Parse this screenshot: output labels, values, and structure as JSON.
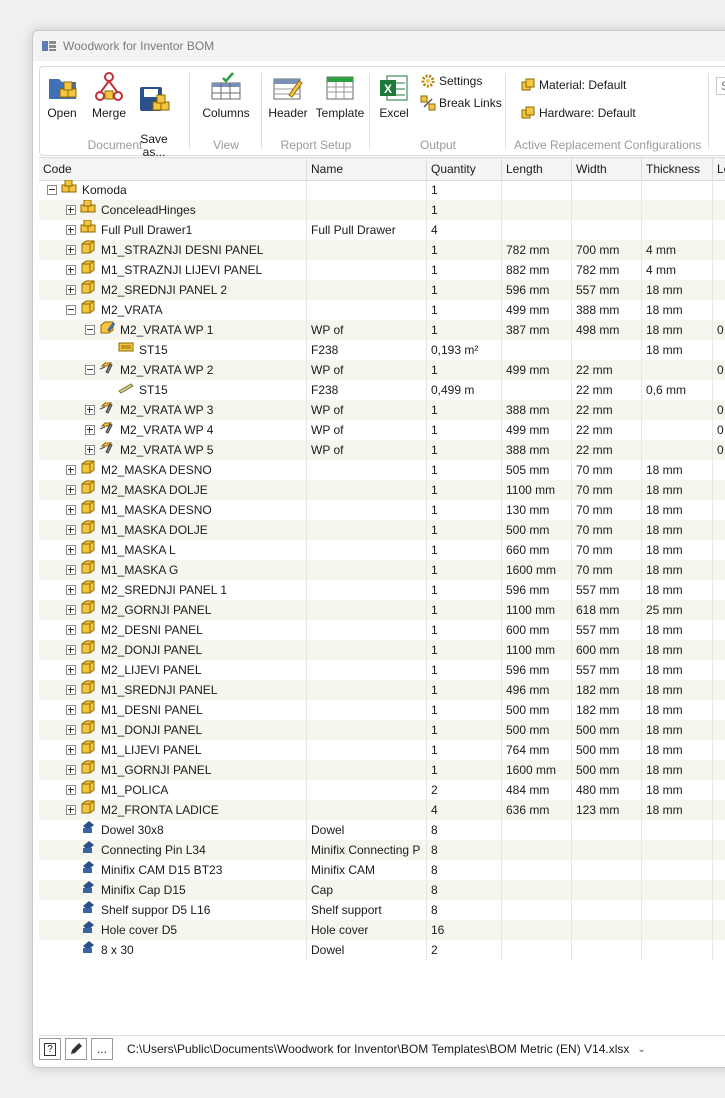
{
  "window": {
    "title": "Woodwork for Inventor BOM"
  },
  "ribbon": {
    "document": {
      "label": "Document",
      "open": "Open",
      "merge": "Merge",
      "save": "Save\nas..."
    },
    "view": {
      "label": "View",
      "columns": "Columns"
    },
    "report_setup": {
      "label": "Report Setup",
      "header": "Header",
      "template": "Template"
    },
    "output": {
      "label": "Output",
      "excel": "Excel",
      "settings": "Settings",
      "break_links": "Break Links"
    },
    "active_replacement": {
      "label": "Active Replacement Configurations",
      "material": "Material: Default",
      "hardware": "Hardware: Default"
    },
    "search_placeholder": "S"
  },
  "columns": [
    "Code",
    "Name",
    "Quantity",
    "Length",
    "Width",
    "Thickness",
    "Le"
  ],
  "rows": [
    {
      "level": 0,
      "exp": "minus",
      "icon": "assembly",
      "code": "Komoda",
      "name": "",
      "qty": "1",
      "len": "",
      "wid": "",
      "thk": "",
      "extra": ""
    },
    {
      "level": 1,
      "exp": "plus",
      "icon": "assembly",
      "code": "ConceleadHinges",
      "name": "",
      "qty": "1",
      "len": "",
      "wid": "",
      "thk": "",
      "extra": ""
    },
    {
      "level": 1,
      "exp": "plus",
      "icon": "assembly",
      "code": "Full Pull Drawer1",
      "name": "Full Pull Drawer",
      "qty": "4",
      "len": "",
      "wid": "",
      "thk": "",
      "extra": ""
    },
    {
      "level": 1,
      "exp": "plus",
      "icon": "part",
      "code": "M1_STRAZNJI DESNI PANEL",
      "name": "",
      "qty": "1",
      "len": "782 mm",
      "wid": "700 mm",
      "thk": "4 mm",
      "extra": ""
    },
    {
      "level": 1,
      "exp": "plus",
      "icon": "part",
      "code": "M1_STRAZNJI LIJEVI PANEL",
      "name": "",
      "qty": "1",
      "len": "882 mm",
      "wid": "782 mm",
      "thk": "4 mm",
      "extra": ""
    },
    {
      "level": 1,
      "exp": "plus",
      "icon": "part",
      "code": "M2_SREDNJI PANEL 2",
      "name": "",
      "qty": "1",
      "len": "596 mm",
      "wid": "557 mm",
      "thk": "18 mm",
      "extra": ""
    },
    {
      "level": 1,
      "exp": "minus",
      "icon": "part",
      "code": "M2_VRATA",
      "name": "",
      "qty": "1",
      "len": "499 mm",
      "wid": "388 mm",
      "thk": "18 mm",
      "extra": ""
    },
    {
      "level": 2,
      "exp": "minus",
      "icon": "wp",
      "code": "M2_VRATA WP 1",
      "name": "WP of",
      "qty": "1",
      "len": "387 mm",
      "wid": "498 mm",
      "thk": "18 mm",
      "extra": "0"
    },
    {
      "level": 3,
      "exp": "none",
      "icon": "sheet",
      "code": "ST15",
      "name": "F238",
      "qty": "0,193 m²",
      "len": "",
      "wid": "",
      "thk": "18 mm",
      "extra": ""
    },
    {
      "level": 2,
      "exp": "minus",
      "icon": "wp2",
      "code": "M2_VRATA WP 2",
      "name": "WP of",
      "qty": "1",
      "len": "499 mm",
      "wid": "22 mm",
      "thk": "",
      "extra": "0"
    },
    {
      "level": 3,
      "exp": "none",
      "icon": "strip",
      "code": "ST15",
      "name": "F238",
      "qty": "0,499 m",
      "len": "",
      "wid": "22 mm",
      "thk": "0,6 mm",
      "extra": ""
    },
    {
      "level": 2,
      "exp": "plus",
      "icon": "wp2",
      "code": "M2_VRATA WP 3",
      "name": "WP of",
      "qty": "1",
      "len": "388 mm",
      "wid": "22 mm",
      "thk": "",
      "extra": "0"
    },
    {
      "level": 2,
      "exp": "plus",
      "icon": "wp2",
      "code": "M2_VRATA WP 4",
      "name": "WP of",
      "qty": "1",
      "len": "499 mm",
      "wid": "22 mm",
      "thk": "",
      "extra": "0"
    },
    {
      "level": 2,
      "exp": "plus",
      "icon": "wp2",
      "code": "M2_VRATA WP 5",
      "name": "WP of",
      "qty": "1",
      "len": "388 mm",
      "wid": "22 mm",
      "thk": "",
      "extra": "0"
    },
    {
      "level": 1,
      "exp": "plus",
      "icon": "part",
      "code": "M2_MASKA DESNO",
      "name": "",
      "qty": "1",
      "len": "505 mm",
      "wid": "70 mm",
      "thk": "18 mm",
      "extra": ""
    },
    {
      "level": 1,
      "exp": "plus",
      "icon": "part",
      "code": "M2_MASKA DOLJE",
      "name": "",
      "qty": "1",
      "len": "1100 mm",
      "wid": "70 mm",
      "thk": "18 mm",
      "extra": ""
    },
    {
      "level": 1,
      "exp": "plus",
      "icon": "part",
      "code": "M1_MASKA DESNO",
      "name": "",
      "qty": "1",
      "len": "130 mm",
      "wid": "70 mm",
      "thk": "18 mm",
      "extra": ""
    },
    {
      "level": 1,
      "exp": "plus",
      "icon": "part",
      "code": "M1_MASKA DOLJE",
      "name": "",
      "qty": "1",
      "len": "500 mm",
      "wid": "70 mm",
      "thk": "18 mm",
      "extra": ""
    },
    {
      "level": 1,
      "exp": "plus",
      "icon": "part",
      "code": "M1_MASKA L",
      "name": "",
      "qty": "1",
      "len": "660 mm",
      "wid": "70 mm",
      "thk": "18 mm",
      "extra": ""
    },
    {
      "level": 1,
      "exp": "plus",
      "icon": "part",
      "code": "M1_MASKA G",
      "name": "",
      "qty": "1",
      "len": "1600 mm",
      "wid": "70 mm",
      "thk": "18 mm",
      "extra": ""
    },
    {
      "level": 1,
      "exp": "plus",
      "icon": "part",
      "code": "M2_SREDNJI PANEL 1",
      "name": "",
      "qty": "1",
      "len": "596 mm",
      "wid": "557 mm",
      "thk": "18 mm",
      "extra": ""
    },
    {
      "level": 1,
      "exp": "plus",
      "icon": "part",
      "code": "M2_GORNJI PANEL",
      "name": "",
      "qty": "1",
      "len": "1100 mm",
      "wid": "618 mm",
      "thk": "25 mm",
      "extra": ""
    },
    {
      "level": 1,
      "exp": "plus",
      "icon": "part",
      "code": "M2_DESNI PANEL",
      "name": "",
      "qty": "1",
      "len": "600 mm",
      "wid": "557 mm",
      "thk": "18 mm",
      "extra": ""
    },
    {
      "level": 1,
      "exp": "plus",
      "icon": "part",
      "code": "M2_DONJI PANEL",
      "name": "",
      "qty": "1",
      "len": "1100 mm",
      "wid": "600 mm",
      "thk": "18 mm",
      "extra": ""
    },
    {
      "level": 1,
      "exp": "plus",
      "icon": "part",
      "code": "M2_LIJEVI PANEL",
      "name": "",
      "qty": "1",
      "len": "596 mm",
      "wid": "557 mm",
      "thk": "18 mm",
      "extra": ""
    },
    {
      "level": 1,
      "exp": "plus",
      "icon": "part",
      "code": "M1_SREDNJI PANEL",
      "name": "",
      "qty": "1",
      "len": "496 mm",
      "wid": "182 mm",
      "thk": "18 mm",
      "extra": ""
    },
    {
      "level": 1,
      "exp": "plus",
      "icon": "part",
      "code": "M1_DESNI PANEL",
      "name": "",
      "qty": "1",
      "len": "500 mm",
      "wid": "182 mm",
      "thk": "18 mm",
      "extra": ""
    },
    {
      "level": 1,
      "exp": "plus",
      "icon": "part",
      "code": "M1_DONJI PANEL",
      "name": "",
      "qty": "1",
      "len": "500 mm",
      "wid": "500 mm",
      "thk": "18 mm",
      "extra": ""
    },
    {
      "level": 1,
      "exp": "plus",
      "icon": "part",
      "code": "M1_LIJEVI PANEL",
      "name": "",
      "qty": "1",
      "len": "764 mm",
      "wid": "500 mm",
      "thk": "18 mm",
      "extra": ""
    },
    {
      "level": 1,
      "exp": "plus",
      "icon": "part",
      "code": "M1_GORNJI PANEL",
      "name": "",
      "qty": "1",
      "len": "1600 mm",
      "wid": "500 mm",
      "thk": "18 mm",
      "extra": ""
    },
    {
      "level": 1,
      "exp": "plus",
      "icon": "part",
      "code": "M1_POLICA",
      "name": "",
      "qty": "2",
      "len": "484 mm",
      "wid": "480 mm",
      "thk": "18 mm",
      "extra": ""
    },
    {
      "level": 1,
      "exp": "plus",
      "icon": "part",
      "code": "M2_FRONTA LADICE",
      "name": "",
      "qty": "4",
      "len": "636 mm",
      "wid": "123 mm",
      "thk": "18 mm",
      "extra": ""
    },
    {
      "level": 1,
      "exp": "none",
      "icon": "hardware",
      "code": "Dowel 30x8",
      "name": "Dowel",
      "qty": "8",
      "len": "",
      "wid": "",
      "thk": "",
      "extra": ""
    },
    {
      "level": 1,
      "exp": "none",
      "icon": "hardware",
      "code": "Connecting Pin L34",
      "name": "Minifix Connecting P",
      "qty": "8",
      "len": "",
      "wid": "",
      "thk": "",
      "extra": ""
    },
    {
      "level": 1,
      "exp": "none",
      "icon": "hardware",
      "code": "Minifix CAM D15 BT23",
      "name": "Minifix CAM",
      "qty": "8",
      "len": "",
      "wid": "",
      "thk": "",
      "extra": ""
    },
    {
      "level": 1,
      "exp": "none",
      "icon": "hardware",
      "code": "Minifix Cap D15",
      "name": "Cap",
      "qty": "8",
      "len": "",
      "wid": "",
      "thk": "",
      "extra": ""
    },
    {
      "level": 1,
      "exp": "none",
      "icon": "hardware",
      "code": "Shelf suppor D5 L16",
      "name": "Shelf support",
      "qty": "8",
      "len": "",
      "wid": "",
      "thk": "",
      "extra": ""
    },
    {
      "level": 1,
      "exp": "none",
      "icon": "hardware",
      "code": "Hole cover D5",
      "name": "Hole cover",
      "qty": "16",
      "len": "",
      "wid": "",
      "thk": "",
      "extra": ""
    },
    {
      "level": 1,
      "exp": "none",
      "icon": "hardware",
      "code": "8 x 30",
      "name": "Dowel",
      "qty": "2",
      "len": "",
      "wid": "",
      "thk": "",
      "extra": ""
    }
  ],
  "status": {
    "help": "?",
    "more": "...",
    "template_path": "C:\\Users\\Public\\Documents\\Woodwork for Inventor\\BOM Templates\\BOM Metric (EN) V14.xlsx"
  },
  "colors": {
    "part": "#f5c542",
    "outline": "#8a6a00",
    "hardware": "#2b4f8a",
    "excel": "#1d7a3a"
  }
}
